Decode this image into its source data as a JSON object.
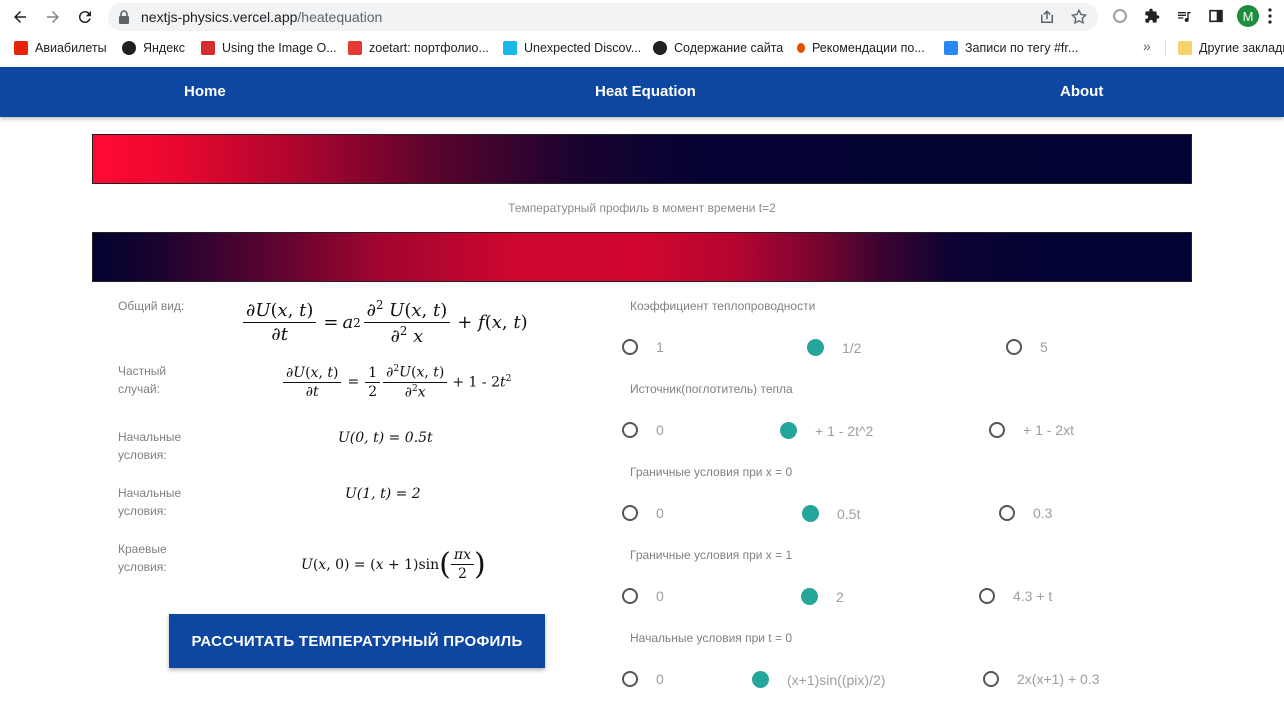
{
  "browser": {
    "url_host": "nextjs-physics.vercel.app",
    "url_path": "/heatequation",
    "avatar_letter": "M",
    "bookmarks": [
      {
        "label": "Авиабилеты",
        "color": "#e8210c"
      },
      {
        "label": "Яндекс",
        "color": "#202124"
      },
      {
        "label": "Using the Image O...",
        "color": "#d32f2f"
      },
      {
        "label": "zoetart: портфолио...",
        "color": "#e53935"
      },
      {
        "label": "Unexpected Discov...",
        "color": "#1ab7ea"
      },
      {
        "label": "Содержание сайта",
        "color": "#202124"
      },
      {
        "label": "Рекомендации по...",
        "color": "#e65100"
      },
      {
        "label": "Записи по тегу #fr...",
        "color": "#2787f5"
      }
    ],
    "overflow": "»",
    "other_bookmarks": "Другие закладки"
  },
  "nav": {
    "home": "Home",
    "heat": "Heat Equation",
    "about": "About"
  },
  "caption": "Температурный профиль в момент времени t=2",
  "equations": {
    "general_label": "Общий вид:",
    "particular_label": "Частный случай:",
    "initial1_label": "Начальные условия:",
    "initial2_label": "Начальные условия:",
    "boundary_label": "Краевые условия:",
    "initial1": "U(0, t) = 0.5t",
    "initial2": "U(1, t) = 2"
  },
  "button_label": "РАССЧИТАТЬ ТЕМПЕРАТУРНЫЙ ПРОФИЛЬ",
  "groups": [
    {
      "title": "Коэффициент теплопроводности",
      "options": [
        "1",
        "1/2",
        "5"
      ],
      "selected": 1
    },
    {
      "title": "Источник(поглотитель) тепла",
      "options": [
        "0",
        "+ 1 - 2t^2",
        "+ 1 - 2xt"
      ],
      "selected": 1
    },
    {
      "title": "Граничные условия при x = 0",
      "options": [
        "0",
        "0.5t",
        "0.3"
      ],
      "selected": 1
    },
    {
      "title": "Граничные условия при x = 1",
      "options": [
        "0",
        "2",
        "4.3 + t"
      ],
      "selected": 1
    },
    {
      "title": "Начальные условия при t = 0",
      "options": [
        "0",
        "(x+1)sin((pix)/2)",
        "2x(x+1) + 0.3"
      ],
      "selected": 1
    }
  ],
  "colors": {
    "accent": "#0d47a1",
    "radio_checked": "#26a69a"
  }
}
